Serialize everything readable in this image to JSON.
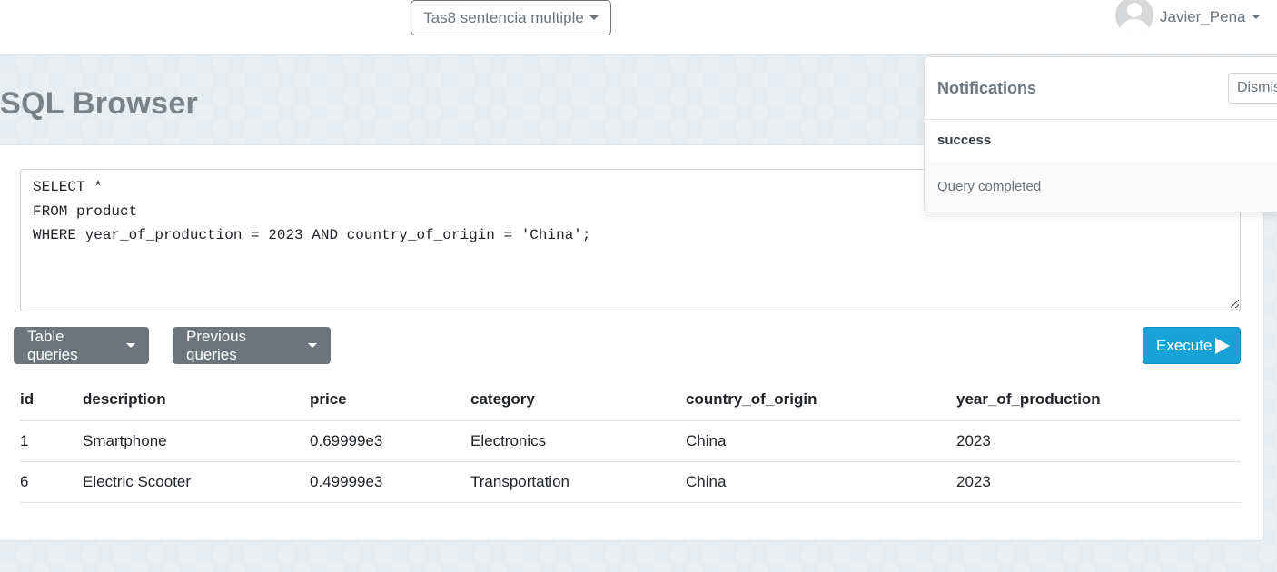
{
  "header": {
    "project_selector": "Tas8 sentencia multiple",
    "username": "Javier_Pena"
  },
  "page": {
    "title": "SQL Browser"
  },
  "editor": {
    "query": "SELECT *\nFROM product\nWHERE year_of_production = 2023 AND country_of_origin = 'China';"
  },
  "buttons": {
    "table_queries": "Table queries",
    "previous_queries": "Previous queries",
    "execute": "Execute"
  },
  "results": {
    "columns": [
      "id",
      "description",
      "price",
      "category",
      "country_of_origin",
      "year_of_production"
    ],
    "rows": [
      [
        "1",
        "Smartphone",
        "0.69999e3",
        "Electronics",
        "China",
        "2023"
      ],
      [
        "6",
        "Electric Scooter",
        "0.49999e3",
        "Transportation",
        "China",
        "2023"
      ]
    ]
  },
  "notification": {
    "title": "Notifications",
    "dismiss_label": "Dismiss",
    "status": "success",
    "message": "Query completed"
  },
  "colors": {
    "execute": "#17a2d8",
    "secondary": "#6c757d"
  }
}
